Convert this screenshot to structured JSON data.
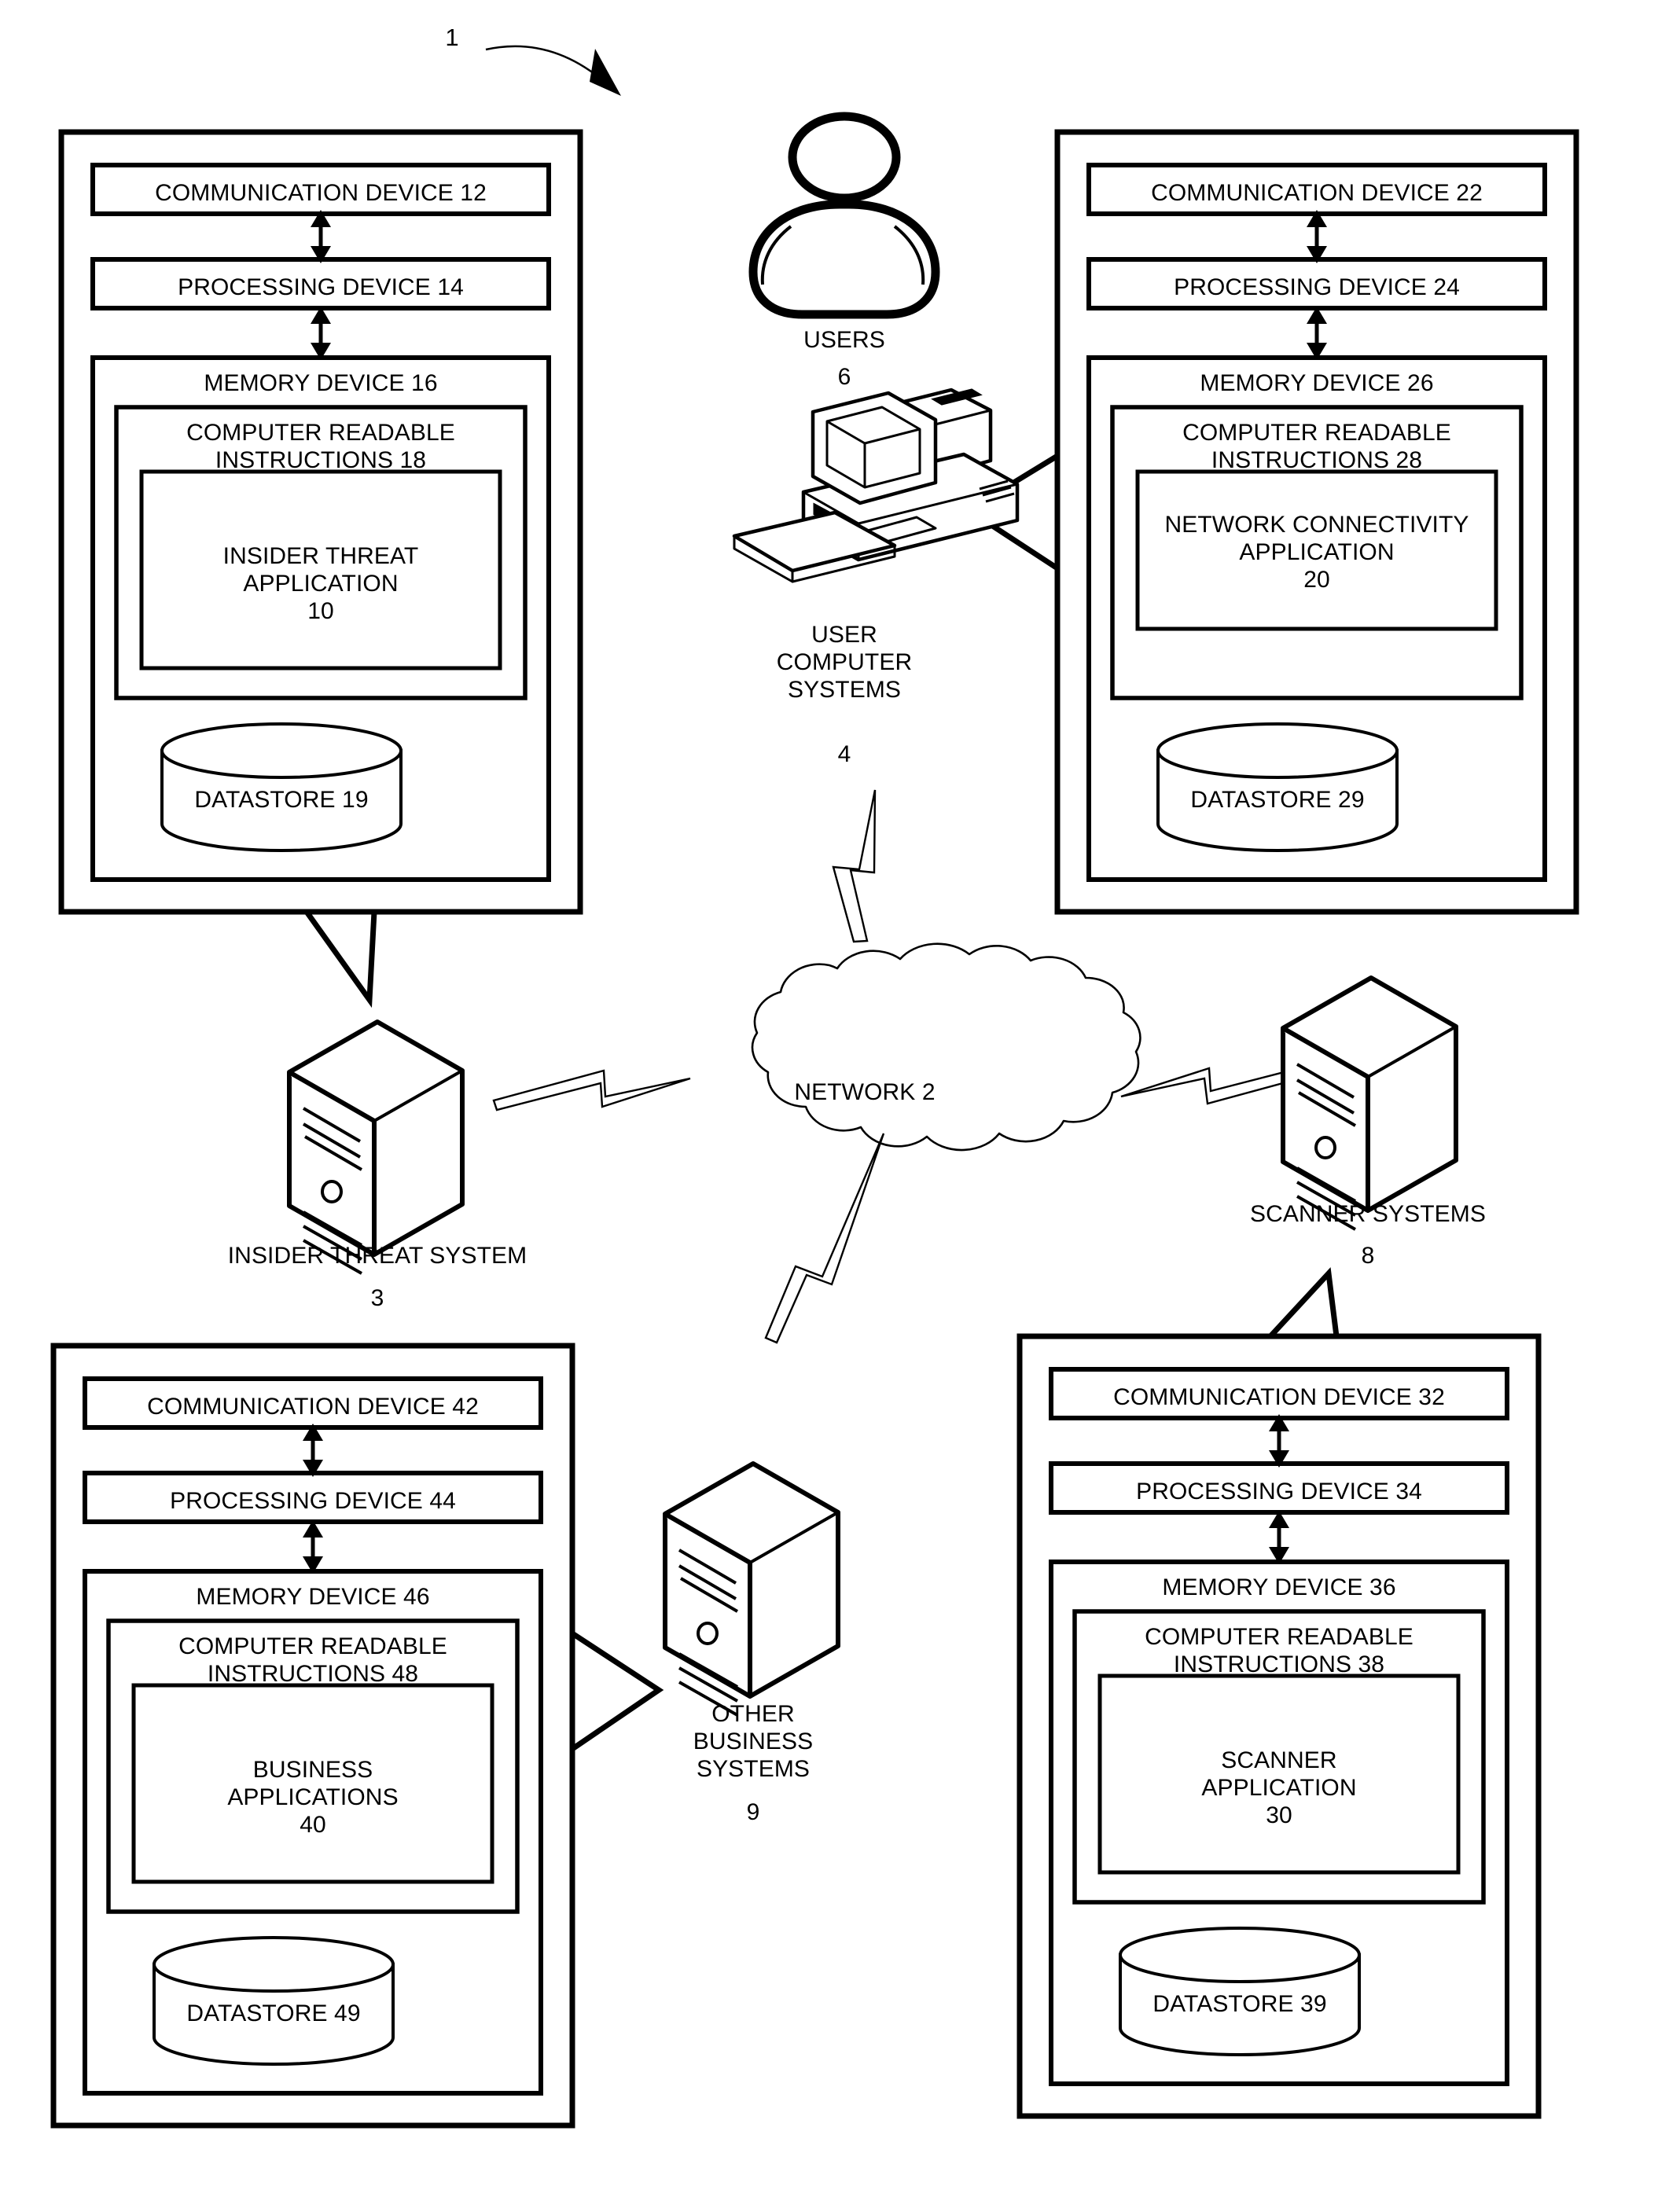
{
  "figure": {
    "reference_numeral": "1",
    "title_hidden": "Insider Threat System Network Architecture"
  },
  "network": {
    "label": "NETWORK 2"
  },
  "nodes": {
    "users": {
      "label": "USERS",
      "ref": "6",
      "icon": "user-person-icon"
    },
    "user_computer_systems": {
      "label": "USER\nCOMPUTER\nSYSTEMS",
      "ref": "4",
      "icon": "desktop-computer-icon"
    },
    "insider_threat_system": {
      "label": "INSIDER THREAT SYSTEM",
      "ref": "3",
      "icon": "server-tower-icon"
    },
    "scanner_systems": {
      "label": "SCANNER SYSTEMS",
      "ref": "8",
      "icon": "server-tower-icon"
    },
    "other_business_systems": {
      "label": "OTHER\nBUSINESS\nSYSTEMS",
      "ref": "9",
      "icon": "server-tower-icon"
    }
  },
  "boxes": {
    "insider_threat": {
      "communication_device": "COMMUNICATION DEVICE 12",
      "processing_device": "PROCESSING DEVICE 14",
      "memory_device": "MEMORY DEVICE 16",
      "computer_readable_instructions": "COMPUTER READABLE\nINSTRUCTIONS 18",
      "application": "INSIDER THREAT\nAPPLICATION\n10",
      "datastore": "DATASTORE 19"
    },
    "user_computer": {
      "communication_device": "COMMUNICATION DEVICE 22",
      "processing_device": "PROCESSING DEVICE 24",
      "memory_device": "MEMORY DEVICE 26",
      "computer_readable_instructions": "COMPUTER READABLE\nINSTRUCTIONS 28",
      "application": "NETWORK CONNECTIVITY\nAPPLICATION\n20",
      "datastore": "DATASTORE 29"
    },
    "other_business": {
      "communication_device": "COMMUNICATION DEVICE 42",
      "processing_device": "PROCESSING DEVICE 44",
      "memory_device": "MEMORY DEVICE 46",
      "computer_readable_instructions": "COMPUTER READABLE\nINSTRUCTIONS 48",
      "application": "BUSINESS\nAPPLICATIONS\n40",
      "datastore": "DATASTORE 49"
    },
    "scanner": {
      "communication_device": "COMMUNICATION DEVICE 32",
      "processing_device": "PROCESSING DEVICE 34",
      "memory_device": "MEMORY DEVICE 36",
      "computer_readable_instructions": "COMPUTER READABLE\nINSTRUCTIONS 38",
      "application": "SCANNER\nAPPLICATION\n30",
      "datastore": "DATASTORE 39"
    }
  },
  "colors": {
    "ink": "#000000",
    "paper": "#ffffff"
  }
}
